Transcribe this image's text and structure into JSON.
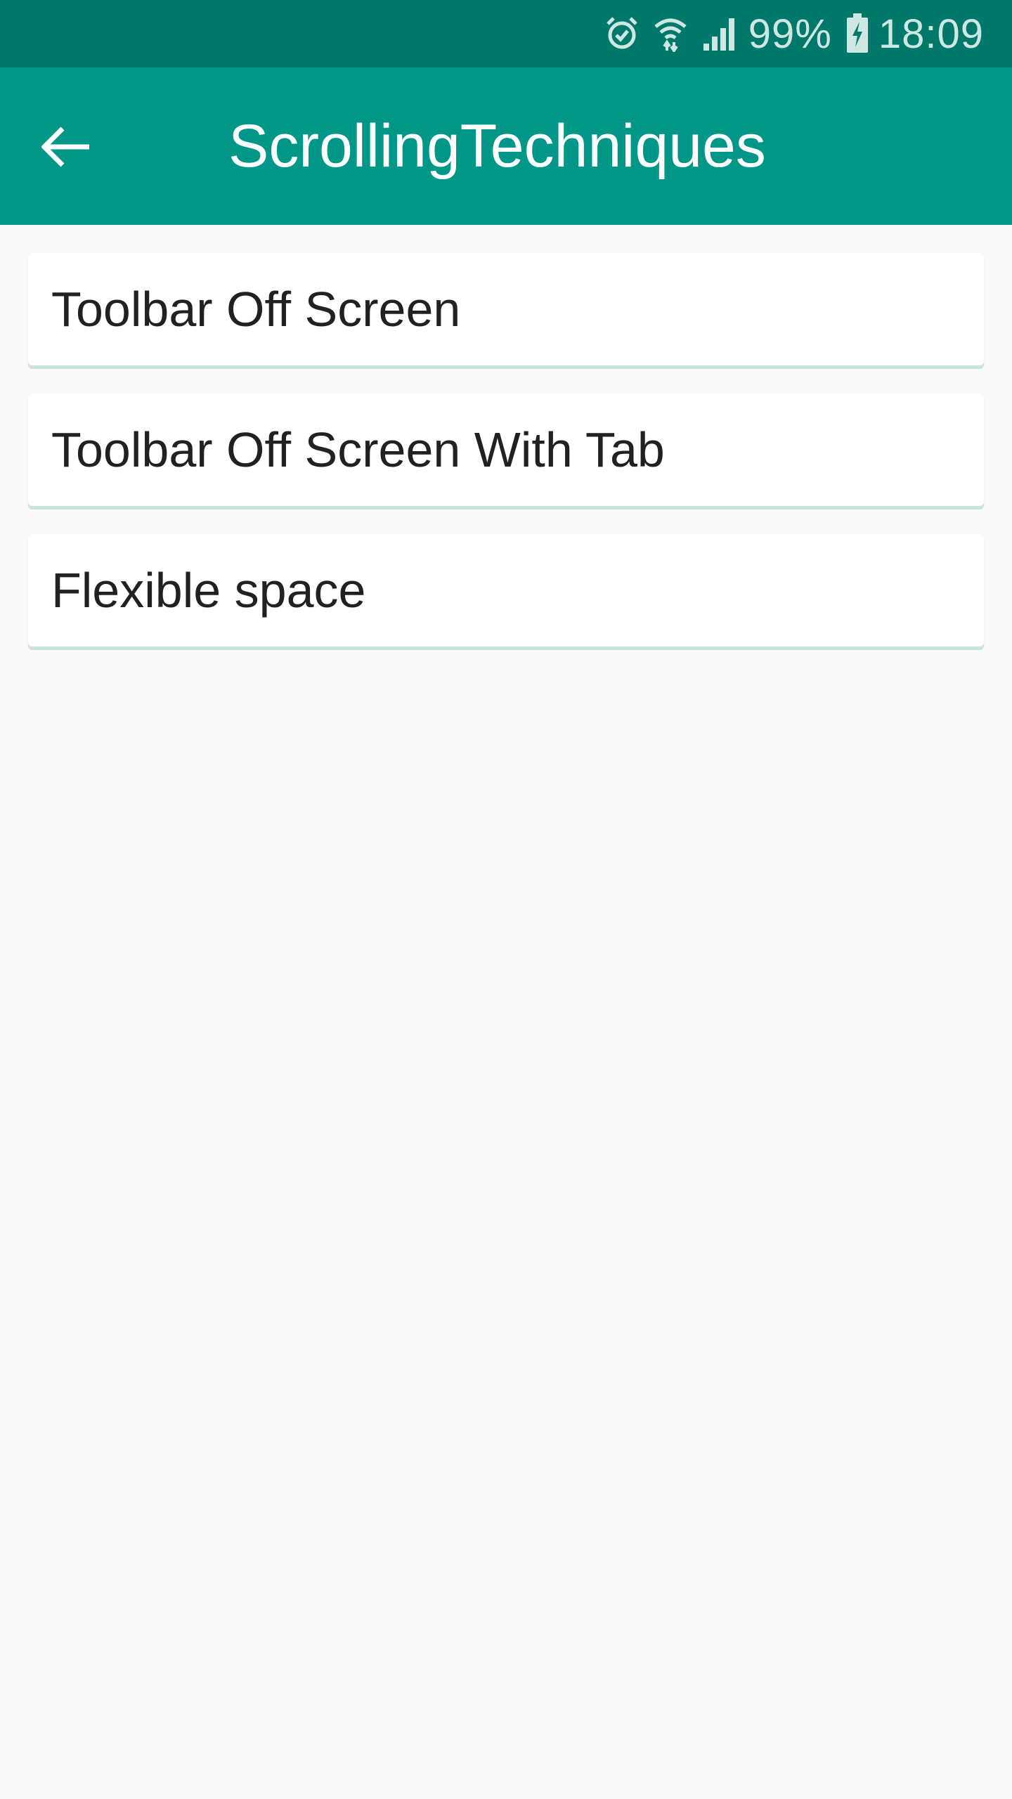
{
  "status_bar": {
    "battery_percent": "99%",
    "time": "18:09",
    "icons": [
      "alarm-icon",
      "wifi-icon",
      "signal-icon",
      "battery-charging-icon"
    ],
    "background": "#00796b"
  },
  "app_bar": {
    "title": "ScrollingTechniques",
    "back_icon": "arrow-back-icon",
    "background": "#009688"
  },
  "list": {
    "items": [
      {
        "label": "Toolbar Off Screen"
      },
      {
        "label": "Toolbar Off Screen With Tab"
      },
      {
        "label": "Flexible space"
      }
    ]
  }
}
